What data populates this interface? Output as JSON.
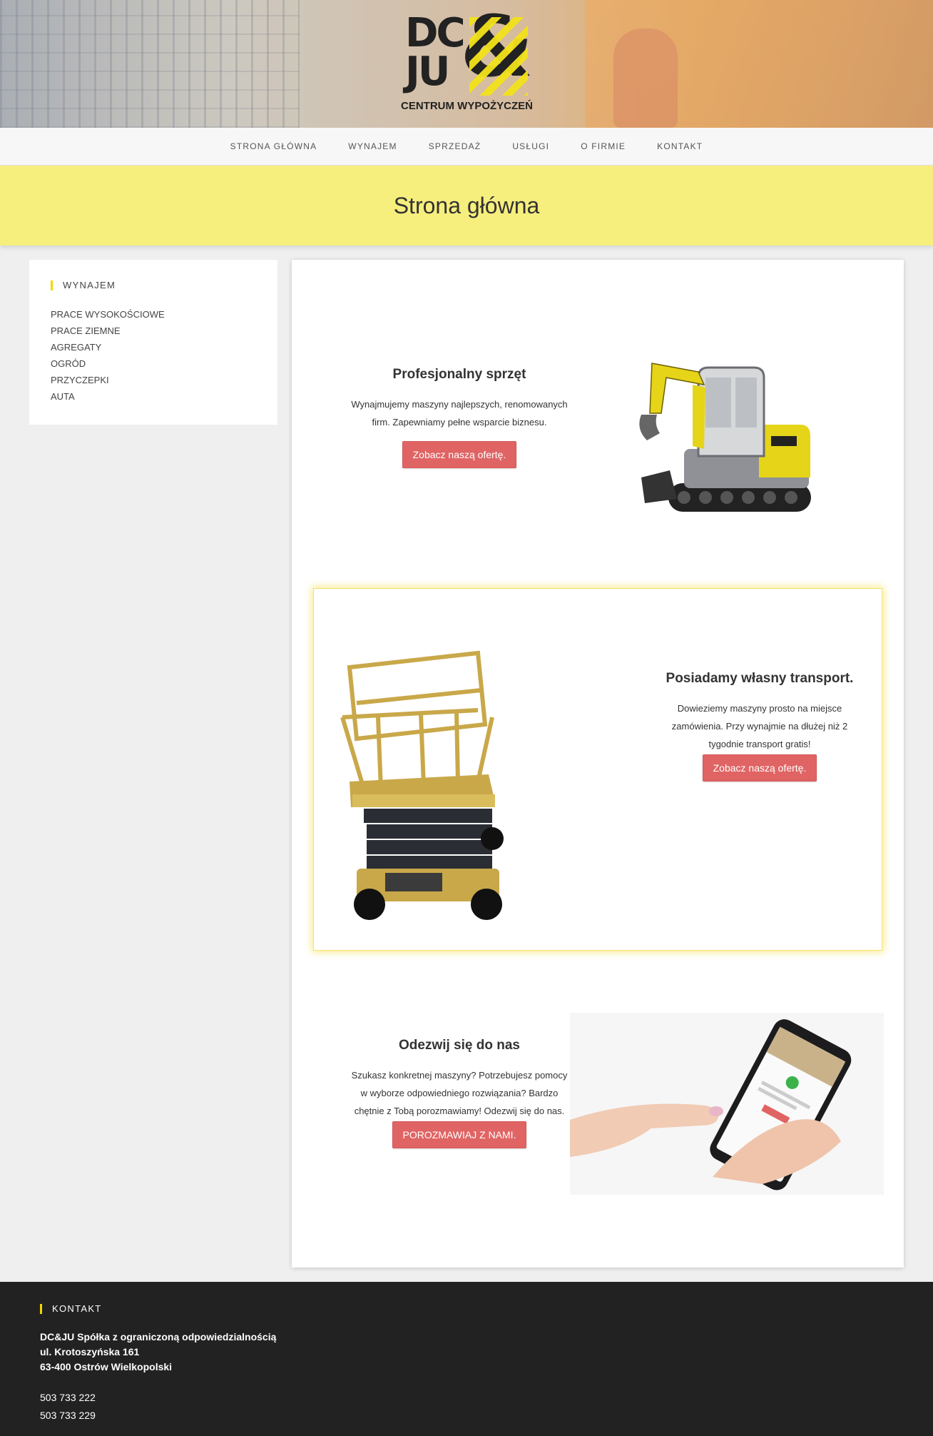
{
  "logo": {
    "letters_top": "DC",
    "letters_bottom": "JU",
    "ampersand": "&",
    "subtitle": "CENTRUM WYPOŻYCZEŃ"
  },
  "nav": {
    "items": [
      "STRONA GŁÓWNA",
      "WYNAJEM",
      "SPRZEDAŻ",
      "USŁUGI",
      "O FIRMIE",
      "KONTAKT"
    ]
  },
  "page": {
    "title": "Strona główna"
  },
  "sidebar": {
    "heading": "WYNAJEM",
    "items": [
      "PRACE WYSOKOŚCIOWE",
      "PRACE ZIEMNE",
      "AGREGATY",
      "OGRÓD",
      "PRZYCZEPKI",
      "AUTA"
    ]
  },
  "sections": [
    {
      "title": "Profesjonalny sprzęt",
      "lines": [
        "Wynajmujemy maszyny najlepszych, renomowanych",
        "firm. Zapewniamy pełne wsparcie biznesu."
      ],
      "button": "Zobacz naszą ofertę.",
      "image": "mini-excavator"
    },
    {
      "title": "Posiadamy własny transport.",
      "lines": [
        "Dowieziemy maszyny prosto na miejsce",
        "zamówienia. Przy wynajmie na dłużej niż 2",
        "tygodnie transport gratis!"
      ],
      "button": "Zobacz naszą ofertę.",
      "image": "scissor-lift"
    },
    {
      "title": "Odezwij się do nas",
      "lines": [
        "Szukasz konkretnej maszyny? Potrzebujesz pomocy",
        "w wyborze odpowiedniego rozwiązania? Bardzo",
        "chętnie z Tobą porozmawiamy! Odezwij się do nas."
      ],
      "button": "POROZMAWIAJ Z NAMI.",
      "image": "hand-holding-smartphone"
    }
  ],
  "footer": {
    "heading": "KONTAKT",
    "address": [
      "DC&JU Spółka z ograniczoną odpowiedzialnością",
      "ul. Krotoszyńska 161",
      "63-400 Ostrów Wielkopolski"
    ],
    "phones": [
      "503 733 222",
      "503 733 229"
    ]
  },
  "colors": {
    "accent_yellow": "#f7ef7d",
    "button_red": "#e06464",
    "footer_bg": "#222222"
  }
}
